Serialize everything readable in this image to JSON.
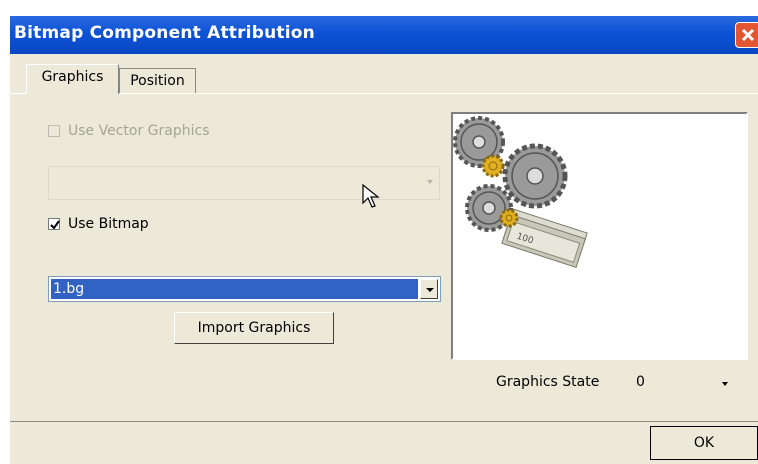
{
  "window": {
    "title": "Bitmap Component Attribution"
  },
  "tabs": [
    {
      "label": "Graphics",
      "active": true
    },
    {
      "label": "Position",
      "active": false
    }
  ],
  "graphics": {
    "use_vector": {
      "label": "Use Vector Graphics",
      "checked": false,
      "enabled": false
    },
    "vector_select": {
      "value": "",
      "enabled": false
    },
    "use_bitmap": {
      "label": "Use Bitmap",
      "checked": true
    },
    "bitmap_select": {
      "value": "1.bg"
    },
    "import_button": "Import Graphics"
  },
  "graphics_state": {
    "label": "Graphics State",
    "value": "0"
  },
  "buttons": {
    "ok": "OK"
  },
  "colors": {
    "titlebar": "#0d52d6",
    "selection": "#3163c5",
    "dialog_bg": "#ece9d8",
    "close": "#e45532"
  },
  "icons": [
    "close-icon",
    "checkmark-icon",
    "chevron-down-icon",
    "gears-money-image",
    "mouse-cursor"
  ]
}
